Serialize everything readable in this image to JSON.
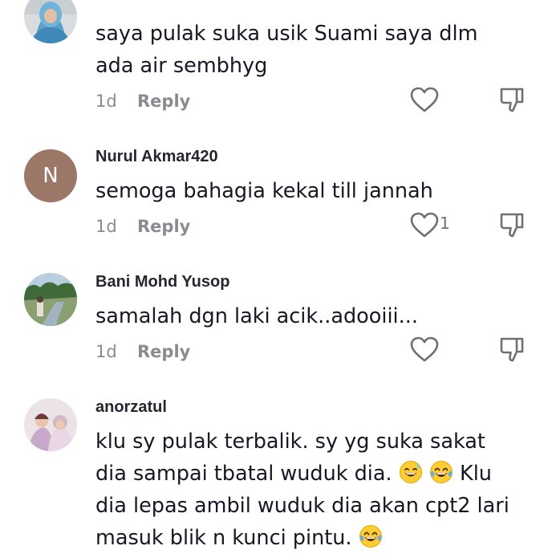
{
  "comments": [
    {
      "avatar": "photo-avatar-hijab",
      "username": "",
      "text_lines": [
        "saya pulak suka usik Suami saya dlm",
        "ada air sembhyg"
      ],
      "time": "1d",
      "reply_label": "Reply",
      "like_count": ""
    },
    {
      "avatar": "letter-avatar",
      "avatar_letter": "N",
      "username": "Nurul Akmar420",
      "text_lines": [
        "semoga bahagia kekal till jannah"
      ],
      "time": "1d",
      "reply_label": "Reply",
      "like_count": "1"
    },
    {
      "avatar": "photo-avatar-landscape",
      "username": "Bani Mohd Yusop",
      "text_lines": [
        "samalah dgn laki acik..adooiii..."
      ],
      "time": "1d",
      "reply_label": "Reply",
      "like_count": ""
    },
    {
      "avatar": "photo-avatar-couple",
      "username": "anorzatul",
      "text_lines": [
        "klu sy pulak terbalik. sy yg suka sakat",
        "dia sampai tbatal wuduk dia.",
        "Klu",
        "dia lepas ambil wuduk dia akan cpt2 lari",
        "masuk blik n kunci pintu."
      ],
      "emojis": [
        "sweat-smile-emoji",
        "tears-of-joy-emoji"
      ],
      "time": "",
      "reply_label": ""
    }
  ],
  "colors": {
    "text": "#161823",
    "muted": "#8a8b91",
    "letter_avatar_bg": "#9b7768"
  }
}
